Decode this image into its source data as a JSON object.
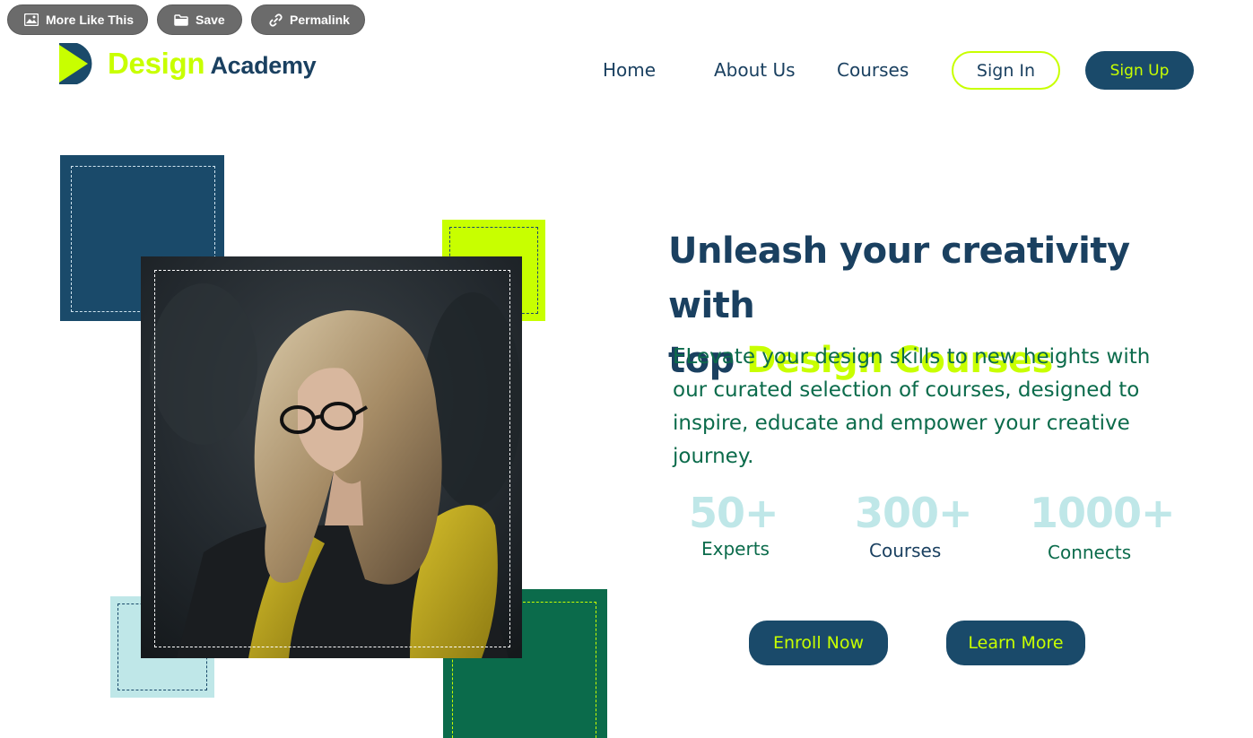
{
  "toolbar": {
    "more_like_this": "More Like This",
    "save": "Save",
    "permalink": "Permalink"
  },
  "logo": {
    "design": "Design",
    "academy": "Academy"
  },
  "nav": {
    "home": "Home",
    "about": "About Us",
    "courses": "Courses",
    "sign_in": "Sign In",
    "sign_up": "Sign Up"
  },
  "hero": {
    "headline_part1": "Unleash your creativity with",
    "headline_part2": "top ",
    "headline_accent": "Design Courses",
    "subtext": "ELevate your design skills to new heights with our curated selection of courses, designed to inspire, educate and empower your creative journey."
  },
  "stats": [
    {
      "value": "50+",
      "label": "Experts"
    },
    {
      "value": "300+",
      "label": "Courses"
    },
    {
      "value": "1000+",
      "label": "Connects"
    }
  ],
  "cta": {
    "enroll": "Enroll Now",
    "learn": "Learn More"
  },
  "colors": {
    "navy": "#1a4a6a",
    "lime": "#c8ff00",
    "green": "#0b6b4b",
    "light_blue": "#bfe7e8"
  },
  "icons": [
    "image-icon",
    "folder-icon",
    "link-icon",
    "play-logo-icon"
  ]
}
